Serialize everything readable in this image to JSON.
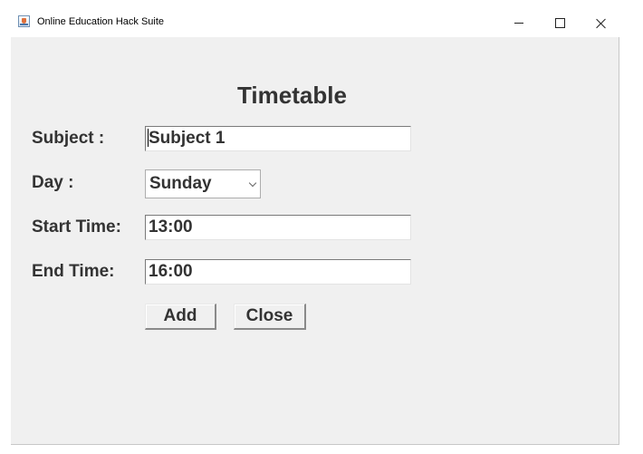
{
  "window": {
    "title": "Online Education Hack Suite",
    "controls": {
      "minimize_icon": "minimize-icon",
      "maximize_icon": "maximize-icon",
      "close_icon": "close-icon"
    }
  },
  "form": {
    "heading": "Timetable",
    "subject": {
      "label": "Subject :",
      "value": "Subject 1"
    },
    "day": {
      "label": "Day :",
      "selected": "Sunday"
    },
    "start_time": {
      "label": "Start Time:",
      "value": "13:00"
    },
    "end_time": {
      "label": "End Time:",
      "value": "16:00"
    },
    "buttons": {
      "add": "Add",
      "close": "Close"
    }
  },
  "colors": {
    "window_bg": "#f0f0f0",
    "text": "#333333",
    "field_bg": "#ffffff"
  }
}
